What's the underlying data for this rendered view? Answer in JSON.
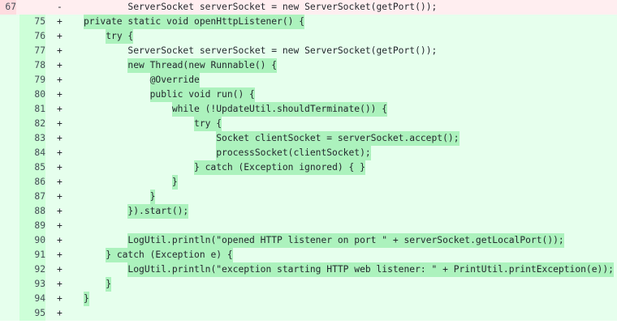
{
  "diff": {
    "lines": [
      {
        "type": "del",
        "old": "67",
        "new": "",
        "marker": "-",
        "indent": "        ",
        "text": "ServerSocket serverSocket = new ServerSocket(getPort());",
        "hl": false
      },
      {
        "type": "add",
        "old": "",
        "new": "75",
        "marker": "+",
        "indent": "",
        "text": "private static void openHttpListener() {",
        "hl": true
      },
      {
        "type": "add",
        "old": "",
        "new": "76",
        "marker": "+",
        "indent": "    ",
        "text": "try {",
        "hl": true
      },
      {
        "type": "add",
        "old": "",
        "new": "77",
        "marker": "+",
        "indent": "        ",
        "text": "ServerSocket serverSocket = new ServerSocket(getPort());",
        "hl": false
      },
      {
        "type": "add",
        "old": "",
        "new": "78",
        "marker": "+",
        "indent": "        ",
        "text": "new Thread(new Runnable() {",
        "hl": true
      },
      {
        "type": "add",
        "old": "",
        "new": "79",
        "marker": "+",
        "indent": "            ",
        "text": "@Override",
        "hl": true
      },
      {
        "type": "add",
        "old": "",
        "new": "80",
        "marker": "+",
        "indent": "            ",
        "text": "public void run() {",
        "hl": true
      },
      {
        "type": "add",
        "old": "",
        "new": "81",
        "marker": "+",
        "indent": "                ",
        "text": "while (!UpdateUtil.shouldTerminate()) {",
        "hl": true
      },
      {
        "type": "add",
        "old": "",
        "new": "82",
        "marker": "+",
        "indent": "                    ",
        "text": "try {",
        "hl": true
      },
      {
        "type": "add",
        "old": "",
        "new": "83",
        "marker": "+",
        "indent": "                        ",
        "text": "Socket clientSocket = serverSocket.accept();",
        "hl": true
      },
      {
        "type": "add",
        "old": "",
        "new": "84",
        "marker": "+",
        "indent": "                        ",
        "text": "processSocket(clientSocket);",
        "hl": true
      },
      {
        "type": "add",
        "old": "",
        "new": "85",
        "marker": "+",
        "indent": "                    ",
        "text": "} catch (Exception ignored) { }",
        "hl": true
      },
      {
        "type": "add",
        "old": "",
        "new": "86",
        "marker": "+",
        "indent": "                ",
        "text": "}",
        "hl": true
      },
      {
        "type": "add",
        "old": "",
        "new": "87",
        "marker": "+",
        "indent": "            ",
        "text": "}",
        "hl": true
      },
      {
        "type": "add",
        "old": "",
        "new": "88",
        "marker": "+",
        "indent": "        ",
        "text": "}).start();",
        "hl": true
      },
      {
        "type": "add",
        "old": "",
        "new": "89",
        "marker": "+",
        "indent": "",
        "text": "",
        "hl": false
      },
      {
        "type": "add",
        "old": "",
        "new": "90",
        "marker": "+",
        "indent": "        ",
        "text": "LogUtil.println(\"opened HTTP listener on port \" + serverSocket.getLocalPort());",
        "hl": true
      },
      {
        "type": "add",
        "old": "",
        "new": "91",
        "marker": "+",
        "indent": "    ",
        "text": "} catch (Exception e) {",
        "hl": true
      },
      {
        "type": "add",
        "old": "",
        "new": "92",
        "marker": "+",
        "indent": "        ",
        "text": "LogUtil.println(\"exception starting HTTP web listener: \" + PrintUtil.printException(e));",
        "hl": true
      },
      {
        "type": "add",
        "old": "",
        "new": "93",
        "marker": "+",
        "indent": "    ",
        "text": "}",
        "hl": true
      },
      {
        "type": "add",
        "old": "",
        "new": "94",
        "marker": "+",
        "indent": "",
        "text": "}",
        "hl": true
      },
      {
        "type": "add",
        "old": "",
        "new": "95",
        "marker": "+",
        "indent": "",
        "text": "",
        "hl": false
      }
    ]
  }
}
